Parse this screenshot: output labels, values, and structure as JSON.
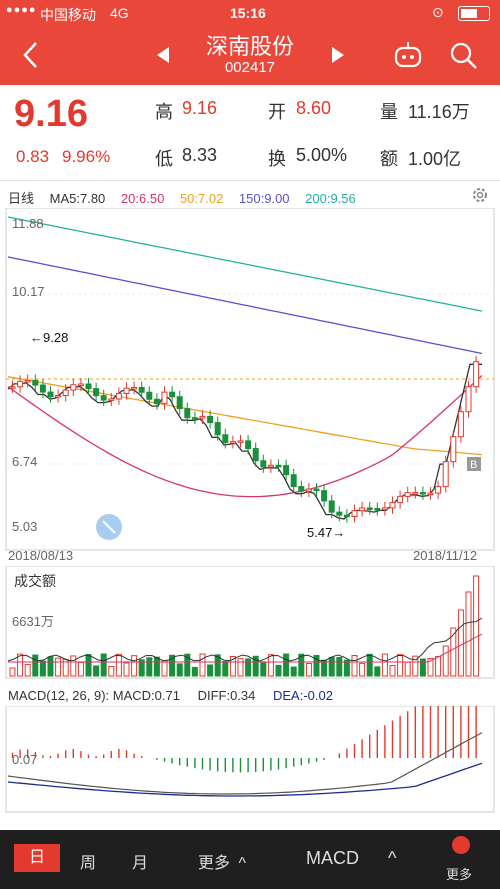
{
  "status": {
    "carrier": "中国移动",
    "network": "4G",
    "time": "15:16"
  },
  "nav": {
    "title": "深南股份",
    "code": "002417"
  },
  "quote": {
    "price": "9.16",
    "change": "0.83",
    "change_pct": "9.96%",
    "high_label": "高",
    "high": "9.16",
    "low_label": "低",
    "low": "8.33",
    "open_label": "开",
    "open": "8.60",
    "turnover_label": "换",
    "turnover": "5.00%",
    "volume_label": "量",
    "volume": "11.16万",
    "amount_label": "额",
    "amount": "1.00亿"
  },
  "kline": {
    "period_label": "日线",
    "ma5": "MA5:7.80",
    "ma20": "20:6.50",
    "ma50": "50:7.02",
    "ma150": "150:9.00",
    "ma200": "200:9.56",
    "colors": {
      "ma5": "#333333",
      "ma20": "#d6336c",
      "ma50": "#f0a020",
      "ma150": "#5a4fcf",
      "ma200": "#20b2a0",
      "up": "#e23a2f",
      "down": "#1a8f3c"
    },
    "y_top": "11.88",
    "y_mid": "10.17",
    "y_low": "6.74",
    "y_bottom": "5.03",
    "annot_high": "←9.28",
    "annot_low": "5.47→",
    "date_start": "2018/08/13",
    "date_end": "2018/11/12",
    "b_marker": "B"
  },
  "volume": {
    "title": "成交额",
    "max": "6631万"
  },
  "macd": {
    "label": "MACD(12, 26, 9): MACD:0.71",
    "diff": "DIFF:0.34",
    "dea": "DEA:-0.02",
    "zero": "0.07"
  },
  "bottombar": {
    "day": "日",
    "week": "周",
    "month": "月",
    "more": "更多",
    "indicator": "MACD",
    "more2": "更多"
  }
}
